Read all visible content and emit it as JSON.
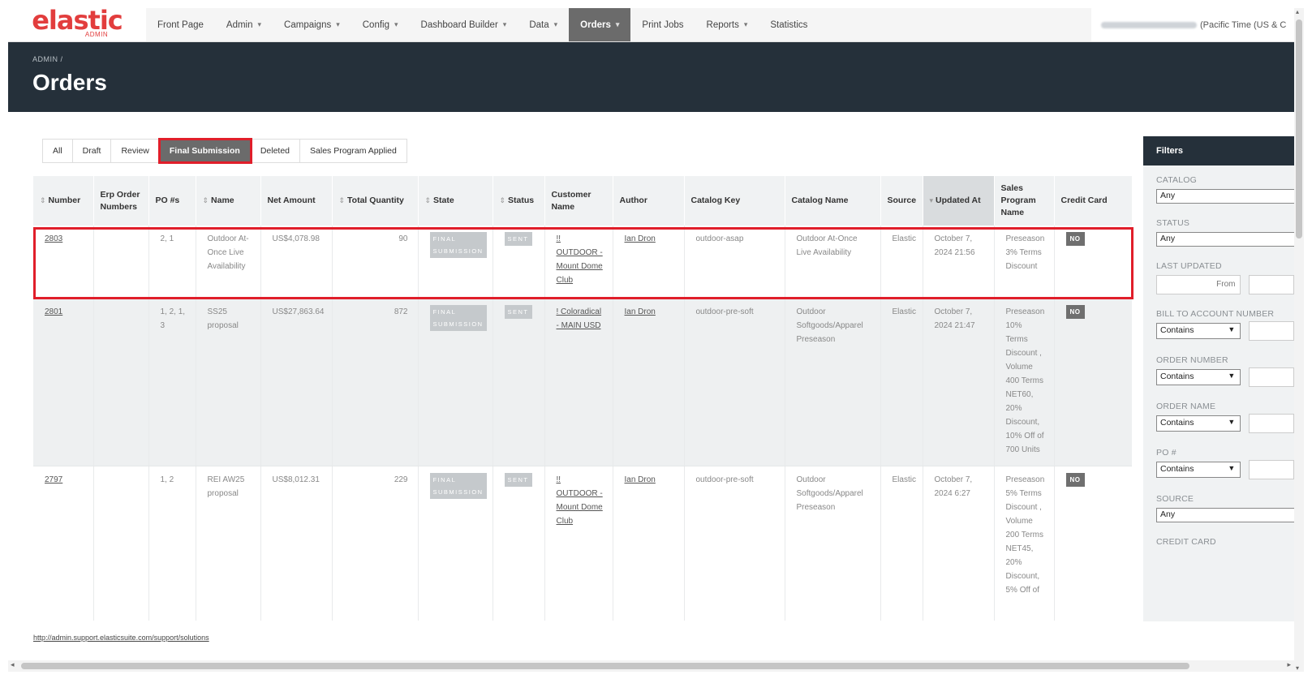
{
  "nav": {
    "logo_text": "elastic",
    "logo_sub": "ADMIN",
    "items": [
      {
        "label": "Front Page",
        "caret": false
      },
      {
        "label": "Admin",
        "caret": true
      },
      {
        "label": "Campaigns",
        "caret": true
      },
      {
        "label": "Config",
        "caret": true
      },
      {
        "label": "Dashboard Builder",
        "caret": true
      },
      {
        "label": "Data",
        "caret": true
      },
      {
        "label": "Orders",
        "caret": true,
        "active": true
      },
      {
        "label": "Print Jobs",
        "caret": false
      },
      {
        "label": "Reports",
        "caret": true
      },
      {
        "label": "Statistics",
        "caret": false
      }
    ],
    "timezone": "(Pacific Time (US & C"
  },
  "header": {
    "breadcrumb": "ADMIN /",
    "title": "Orders"
  },
  "tabs": [
    {
      "label": "All"
    },
    {
      "label": "Draft"
    },
    {
      "label": "Review"
    },
    {
      "label": "Final Submission",
      "active": true
    },
    {
      "label": "Deleted"
    },
    {
      "label": "Sales Program Applied"
    }
  ],
  "table": {
    "columns": [
      "Number",
      "Erp Order Numbers",
      "PO #s",
      "Name",
      "Net Amount",
      "Total Quantity",
      "State",
      "Status",
      "Customer Name",
      "Author",
      "Catalog Key",
      "Catalog Name",
      "Source",
      "Updated At",
      "Sales Program Name",
      "Credit Card"
    ],
    "rows": [
      {
        "number": "2803",
        "erp": "",
        "po": "2, 1",
        "name": "Outdoor At-Once Live Availability",
        "net": "US$4,078.98",
        "qty": "90",
        "state": "FINAL SUBMISSION",
        "status": "SENT",
        "customer": "!! OUTDOOR - Mount Dome Club",
        "author": "Ian Dron",
        "catalog_key": "outdoor-asap",
        "catalog_name": "Outdoor At-Once Live Availability",
        "source": "Elastic",
        "updated": "October 7, 2024 21:56",
        "sales_program": "Preseason 3% Terms Discount",
        "credit_card": "NO"
      },
      {
        "number": "2801",
        "erp": "",
        "po": "1, 2, 1, 3",
        "name": "SS25 proposal",
        "net": "US$27,863.64",
        "qty": "872",
        "state": "FINAL SUBMISSION",
        "status": "SENT",
        "customer": "! Coloradical - MAIN USD",
        "author": "Ian Dron",
        "catalog_key": "outdoor-pre-soft",
        "catalog_name": "Outdoor Softgoods/Apparel Preseason",
        "source": "Elastic",
        "updated": "October 7, 2024 21:47",
        "sales_program": "Preseason 10% Terms Discount , Volume 400 Terms NET60, 20% Discount, 10% Off of 700 Units",
        "credit_card": "NO"
      },
      {
        "number": "2797",
        "erp": "",
        "po": "1, 2",
        "name": "REI AW25 proposal",
        "net": "US$8,012.31",
        "qty": "229",
        "state": "FINAL SUBMISSION",
        "status": "SENT",
        "customer": "!! OUTDOOR - Mount Dome Club",
        "author": "Ian Dron",
        "catalog_key": "outdoor-pre-soft",
        "catalog_name": "Outdoor Softgoods/Apparel Preseason",
        "source": "Elastic",
        "updated": "October 7, 2024 6:27",
        "sales_program": "Preseason 5% Terms Discount , Volume 200 Terms NET45, 20% Discount, 5% Off of",
        "credit_card": "NO"
      }
    ]
  },
  "filters": {
    "title": "Filters",
    "catalog": {
      "label": "CATALOG",
      "value": "Any"
    },
    "status": {
      "label": "STATUS",
      "value": "Any"
    },
    "last_updated": {
      "label": "LAST UPDATED",
      "from_placeholder": "From"
    },
    "bill_to": {
      "label": "BILL TO ACCOUNT NUMBER",
      "op": "Contains"
    },
    "order_number": {
      "label": "ORDER NUMBER",
      "op": "Contains"
    },
    "order_name": {
      "label": "ORDER NAME",
      "op": "Contains"
    },
    "po": {
      "label": "PO #",
      "op": "Contains"
    },
    "source": {
      "label": "SOURCE",
      "value": "Any"
    },
    "credit_card": {
      "label": "CREDIT CARD"
    }
  },
  "footer": {
    "link": "http://admin.support.elasticsuite.com/support/solutions"
  },
  "colors": {
    "accent_red": "#e01e2a",
    "header_dark": "#25303a",
    "logo_red": "#e23d3d"
  }
}
